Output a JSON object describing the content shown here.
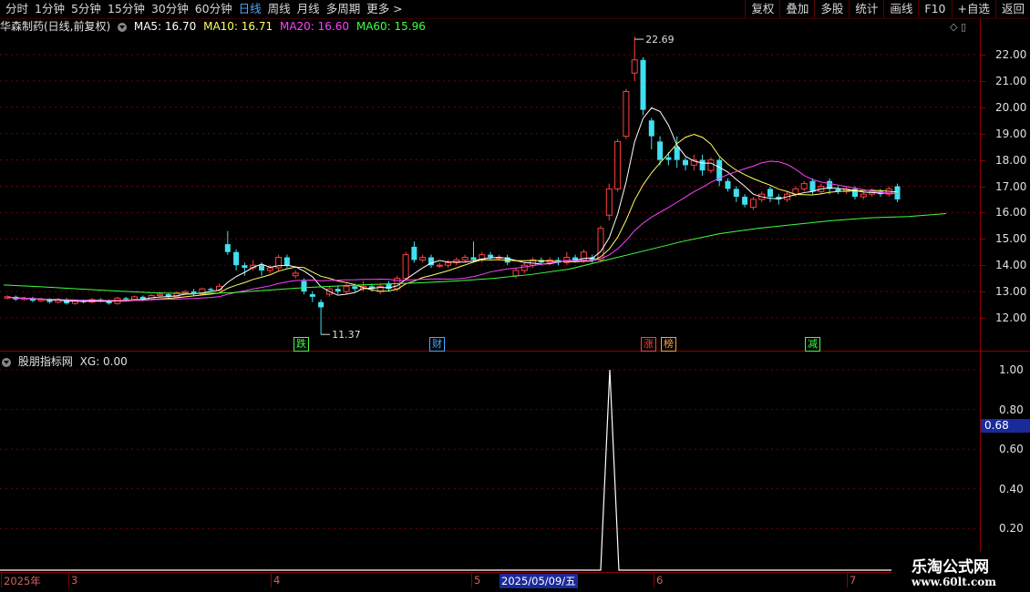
{
  "toolbar": {
    "left": [
      "分时",
      "1分钟",
      "5分钟",
      "15分钟",
      "30分钟",
      "60分钟",
      "日线",
      "周线",
      "月线",
      "多周期",
      "更多 >"
    ],
    "active_index": 6,
    "right": [
      "复权",
      "叠加",
      "多股",
      "统计",
      "画线",
      "F10",
      "+自选",
      "返回"
    ]
  },
  "title": {
    "name": "华森制药(日线,前复权)",
    "ma5": "MA5: 16.70",
    "ma10": "MA10: 16.71",
    "ma20": "MA20: 16.60",
    "ma60": "MA60: 15.96"
  },
  "colors": {
    "up": "#ff4040",
    "down": "#40e0f0",
    "ma5": "#ffffff",
    "ma10": "#ffff60",
    "ma20": "#ff40ff",
    "ma60": "#40ff40"
  },
  "price_axis": [
    "22.00",
    "21.00",
    "20.00",
    "19.00",
    "18.00",
    "17.00",
    "16.00",
    "15.00",
    "14.00",
    "13.00",
    "12.00"
  ],
  "annotations": {
    "high": "22.69",
    "low": "11.37"
  },
  "badges": [
    {
      "text": "跌",
      "color": "#40ff40"
    },
    {
      "text": "财",
      "color": "#4aa8ff"
    },
    {
      "text": "涨",
      "color": "#ff4040"
    },
    {
      "text": "榜",
      "color": "#ffa040"
    },
    {
      "text": "减",
      "color": "#40ff40"
    }
  ],
  "indicator": {
    "title": "股朋指标网",
    "xg": "XG: 0.00",
    "axis": [
      "1.00",
      "0.80",
      "0.60",
      "0.40",
      "0.20"
    ],
    "current": "0.68"
  },
  "date_axis": {
    "labels": [
      "2025年",
      "3",
      "4",
      "5",
      "2025/05/09/五",
      "6",
      "7"
    ]
  },
  "watermark": {
    "line1": "乐淘公式网",
    "line2": "www.60lt.com"
  },
  "chart_data": {
    "type": "candlestick",
    "candles": [
      [
        12.75,
        12.8,
        12.7,
        12.85
      ],
      [
        12.8,
        12.7,
        12.65,
        12.85
      ],
      [
        12.7,
        12.75,
        12.65,
        12.8
      ],
      [
        12.75,
        12.65,
        12.6,
        12.8
      ],
      [
        12.65,
        12.7,
        12.6,
        12.75
      ],
      [
        12.7,
        12.6,
        12.55,
        12.75
      ],
      [
        12.6,
        12.7,
        12.55,
        12.75
      ],
      [
        12.7,
        12.55,
        12.5,
        12.75
      ],
      [
        12.55,
        12.65,
        12.5,
        12.7
      ],
      [
        12.65,
        12.6,
        12.55,
        12.7
      ],
      [
        12.6,
        12.7,
        12.55,
        12.75
      ],
      [
        12.7,
        12.65,
        12.6,
        12.75
      ],
      [
        12.65,
        12.55,
        12.5,
        12.7
      ],
      [
        12.55,
        12.75,
        12.5,
        12.8
      ],
      [
        12.75,
        12.7,
        12.65,
        12.8
      ],
      [
        12.7,
        12.8,
        12.65,
        12.85
      ],
      [
        12.8,
        12.7,
        12.65,
        12.85
      ],
      [
        12.7,
        12.85,
        12.65,
        12.9
      ],
      [
        12.85,
        12.9,
        12.8,
        12.95
      ],
      [
        12.9,
        12.8,
        12.75,
        12.95
      ],
      [
        12.8,
        12.95,
        12.75,
        13.0
      ],
      [
        12.95,
        13.0,
        12.9,
        13.05
      ],
      [
        13.0,
        12.9,
        12.85,
        13.1
      ],
      [
        12.9,
        13.1,
        12.85,
        13.15
      ],
      [
        13.1,
        13.05,
        13.0,
        13.15
      ],
      [
        13.05,
        13.2,
        13.0,
        13.3
      ],
      [
        14.8,
        14.5,
        14.4,
        15.3
      ],
      [
        14.5,
        14.0,
        13.8,
        14.6
      ],
      [
        14.0,
        13.9,
        13.6,
        14.1
      ],
      [
        13.9,
        14.0,
        13.8,
        14.2
      ],
      [
        14.0,
        13.8,
        13.6,
        14.1
      ],
      [
        13.8,
        13.9,
        13.7,
        14.0
      ],
      [
        13.9,
        14.3,
        13.8,
        14.4
      ],
      [
        14.3,
        14.0,
        13.9,
        14.4
      ],
      [
        13.6,
        13.7,
        13.5,
        13.8
      ],
      [
        13.4,
        13.0,
        12.9,
        13.5
      ],
      [
        12.9,
        12.8,
        12.6,
        13.0
      ],
      [
        12.6,
        12.4,
        11.37,
        12.7
      ],
      [
        12.9,
        13.1,
        12.8,
        13.2
      ],
      [
        13.1,
        13.0,
        12.9,
        13.2
      ],
      [
        13.0,
        13.2,
        12.9,
        13.3
      ],
      [
        13.2,
        13.1,
        13.0,
        13.3
      ],
      [
        13.1,
        13.2,
        13.0,
        13.4
      ],
      [
        13.2,
        13.1,
        13.0,
        13.3
      ],
      [
        13.0,
        13.2,
        12.9,
        13.3
      ],
      [
        13.3,
        13.1,
        13.0,
        13.4
      ],
      [
        13.1,
        13.5,
        13.0,
        13.6
      ],
      [
        13.5,
        14.4,
        13.4,
        14.5
      ],
      [
        14.7,
        14.2,
        14.1,
        14.9
      ],
      [
        14.2,
        14.3,
        14.1,
        14.4
      ],
      [
        14.3,
        14.0,
        13.9,
        14.4
      ],
      [
        14.0,
        14.0,
        13.9,
        14.1
      ],
      [
        14.0,
        14.1,
        13.9,
        14.2
      ],
      [
        14.1,
        14.2,
        14.0,
        14.3
      ],
      [
        14.2,
        14.3,
        14.1,
        14.4
      ],
      [
        14.3,
        14.2,
        14.1,
        14.9
      ],
      [
        14.2,
        14.4,
        14.1,
        14.5
      ],
      [
        14.4,
        14.3,
        14.2,
        14.5
      ],
      [
        14.3,
        14.3,
        14.2,
        14.4
      ],
      [
        14.3,
        14.1,
        14.0,
        14.4
      ],
      [
        13.6,
        13.8,
        13.5,
        13.9
      ],
      [
        13.8,
        14.0,
        13.7,
        14.1
      ],
      [
        14.0,
        14.2,
        13.9,
        14.3
      ],
      [
        14.2,
        14.1,
        14.0,
        14.3
      ],
      [
        14.1,
        14.2,
        14.0,
        14.3
      ],
      [
        14.2,
        14.1,
        14.0,
        14.3
      ],
      [
        14.1,
        14.3,
        14.0,
        14.5
      ],
      [
        14.3,
        14.2,
        14.1,
        14.4
      ],
      [
        14.2,
        14.5,
        14.1,
        14.6
      ],
      [
        14.3,
        14.2,
        14.1,
        14.4
      ],
      [
        14.2,
        15.4,
        14.1,
        15.5
      ],
      [
        15.9,
        16.9,
        15.7,
        17.1
      ],
      [
        16.9,
        18.7,
        16.8,
        18.8
      ],
      [
        18.9,
        20.6,
        18.8,
        20.7
      ],
      [
        21.3,
        21.8,
        21.0,
        22.69
      ],
      [
        21.8,
        19.9,
        19.7,
        21.9
      ],
      [
        19.5,
        18.9,
        18.4,
        19.6
      ],
      [
        18.7,
        18.0,
        17.8,
        18.9
      ],
      [
        18.1,
        18.0,
        17.8,
        18.3
      ],
      [
        18.5,
        18.0,
        17.7,
        18.9
      ],
      [
        18.0,
        17.8,
        17.6,
        18.1
      ],
      [
        17.8,
        18.0,
        17.6,
        18.2
      ],
      [
        18.0,
        17.6,
        17.4,
        18.2
      ],
      [
        17.6,
        18.0,
        17.5,
        18.1
      ],
      [
        18.0,
        17.2,
        17.0,
        18.1
      ],
      [
        17.2,
        16.9,
        16.8,
        17.3
      ],
      [
        16.9,
        16.6,
        16.4,
        17.0
      ],
      [
        16.6,
        16.3,
        16.2,
        16.7
      ],
      [
        16.2,
        16.5,
        16.1,
        16.6
      ],
      [
        16.5,
        16.7,
        16.4,
        16.8
      ],
      [
        16.9,
        16.6,
        16.4,
        17.0
      ],
      [
        16.6,
        16.5,
        16.3,
        16.7
      ],
      [
        16.5,
        16.7,
        16.4,
        16.8
      ],
      [
        16.7,
        16.9,
        16.6,
        17.0
      ],
      [
        16.9,
        17.1,
        16.8,
        17.2
      ],
      [
        17.2,
        16.8,
        16.7,
        17.3
      ],
      [
        16.8,
        17.0,
        16.7,
        17.1
      ],
      [
        17.2,
        16.9,
        16.7,
        17.3
      ],
      [
        16.9,
        16.8,
        16.7,
        17.0
      ],
      [
        16.8,
        16.9,
        16.7,
        17.0
      ],
      [
        16.9,
        16.6,
        16.5,
        17.0
      ],
      [
        16.6,
        16.7,
        16.5,
        16.8
      ],
      [
        16.7,
        16.8,
        16.6,
        16.9
      ],
      [
        16.8,
        16.7,
        16.6,
        16.9
      ],
      [
        16.7,
        16.9,
        16.6,
        17.0
      ],
      [
        17.0,
        16.5,
        16.4,
        17.1
      ]
    ],
    "ma60_points": [
      13.25,
      13.18,
      13.1,
      13.02,
      12.95,
      12.92,
      12.95,
      13.05,
      13.15,
      13.22,
      13.28,
      13.33,
      13.4,
      13.5,
      13.65,
      13.85,
      14.2,
      14.55,
      14.9,
      15.2,
      15.4,
      15.55,
      15.7,
      15.8,
      15.85,
      15.96
    ]
  }
}
